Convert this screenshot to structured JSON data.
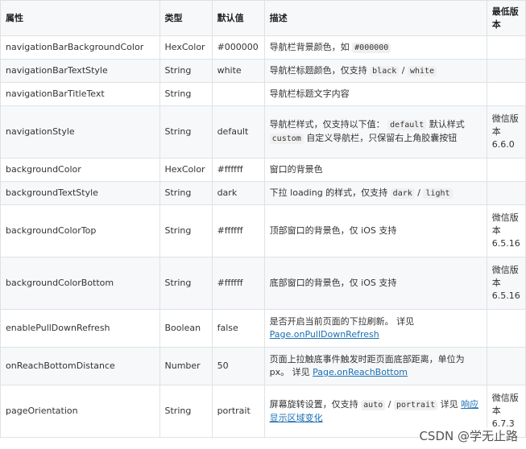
{
  "headers": [
    "属性",
    "类型",
    "默认值",
    "描述",
    "最低版本"
  ],
  "rows": [
    {
      "prop": "navigationBarBackgroundColor",
      "type": "HexColor",
      "def": "#000000",
      "desc": [
        {
          "t": "导航栏背景颜色，如 "
        },
        {
          "c": "#000000"
        }
      ],
      "ver": ""
    },
    {
      "prop": "navigationBarTextStyle",
      "type": "String",
      "def": "white",
      "desc": [
        {
          "t": "导航栏标题颜色，仅支持 "
        },
        {
          "c": "black"
        },
        {
          "t": " / "
        },
        {
          "c": "white"
        }
      ],
      "ver": ""
    },
    {
      "prop": "navigationBarTitleText",
      "type": "String",
      "def": "",
      "desc": [
        {
          "t": "导航栏标题文字内容"
        }
      ],
      "ver": ""
    },
    {
      "prop": "navigationStyle",
      "type": "String",
      "def": "default",
      "desc": [
        {
          "t": "导航栏样式，仅支持以下值： "
        },
        {
          "c": "default"
        },
        {
          "t": " 默认样式 "
        },
        {
          "c": "custom"
        },
        {
          "t": " 自定义导航栏，只保留右上角胶囊按钮"
        }
      ],
      "ver": "微信版本 6.6.0"
    },
    {
      "prop": "backgroundColor",
      "type": "HexColor",
      "def": "#ffffff",
      "desc": [
        {
          "t": "窗口的背景色"
        }
      ],
      "ver": ""
    },
    {
      "prop": "backgroundTextStyle",
      "type": "String",
      "def": "dark",
      "desc": [
        {
          "t": "下拉 loading 的样式，仅支持 "
        },
        {
          "c": "dark"
        },
        {
          "t": " / "
        },
        {
          "c": "light"
        }
      ],
      "ver": ""
    },
    {
      "prop": "backgroundColorTop",
      "type": "String",
      "def": "#ffffff",
      "desc": [
        {
          "t": "顶部窗口的背景色，仅 iOS 支持"
        }
      ],
      "ver": "微信版本 6.5.16"
    },
    {
      "prop": "backgroundColorBottom",
      "type": "String",
      "def": "#ffffff",
      "desc": [
        {
          "t": "底部窗口的背景色，仅 iOS 支持"
        }
      ],
      "ver": "微信版本 6.5.16"
    },
    {
      "prop": "enablePullDownRefresh",
      "type": "Boolean",
      "def": "false",
      "desc": [
        {
          "t": "是否开启当前页面的下拉刷新。 详见 "
        },
        {
          "a": "Page.onPullDownRefresh"
        }
      ],
      "ver": ""
    },
    {
      "prop": "onReachBottomDistance",
      "type": "Number",
      "def": "50",
      "desc": [
        {
          "t": "页面上拉触底事件触发时距页面底部距离，单位为px。 详见 "
        },
        {
          "a": "Page.onReachBottom"
        }
      ],
      "ver": ""
    },
    {
      "prop": "pageOrientation",
      "type": "String",
      "def": "portrait",
      "desc": [
        {
          "t": "屏幕旋转设置，仅支持 "
        },
        {
          "c": "auto"
        },
        {
          "t": " / "
        },
        {
          "c": "portrait"
        },
        {
          "t": " 详见 "
        },
        {
          "a": "响应显示区域变化"
        }
      ],
      "ver": "微信版本 6.7.3"
    }
  ],
  "row_heights": [],
  "watermark": "CSDN @学无止路"
}
